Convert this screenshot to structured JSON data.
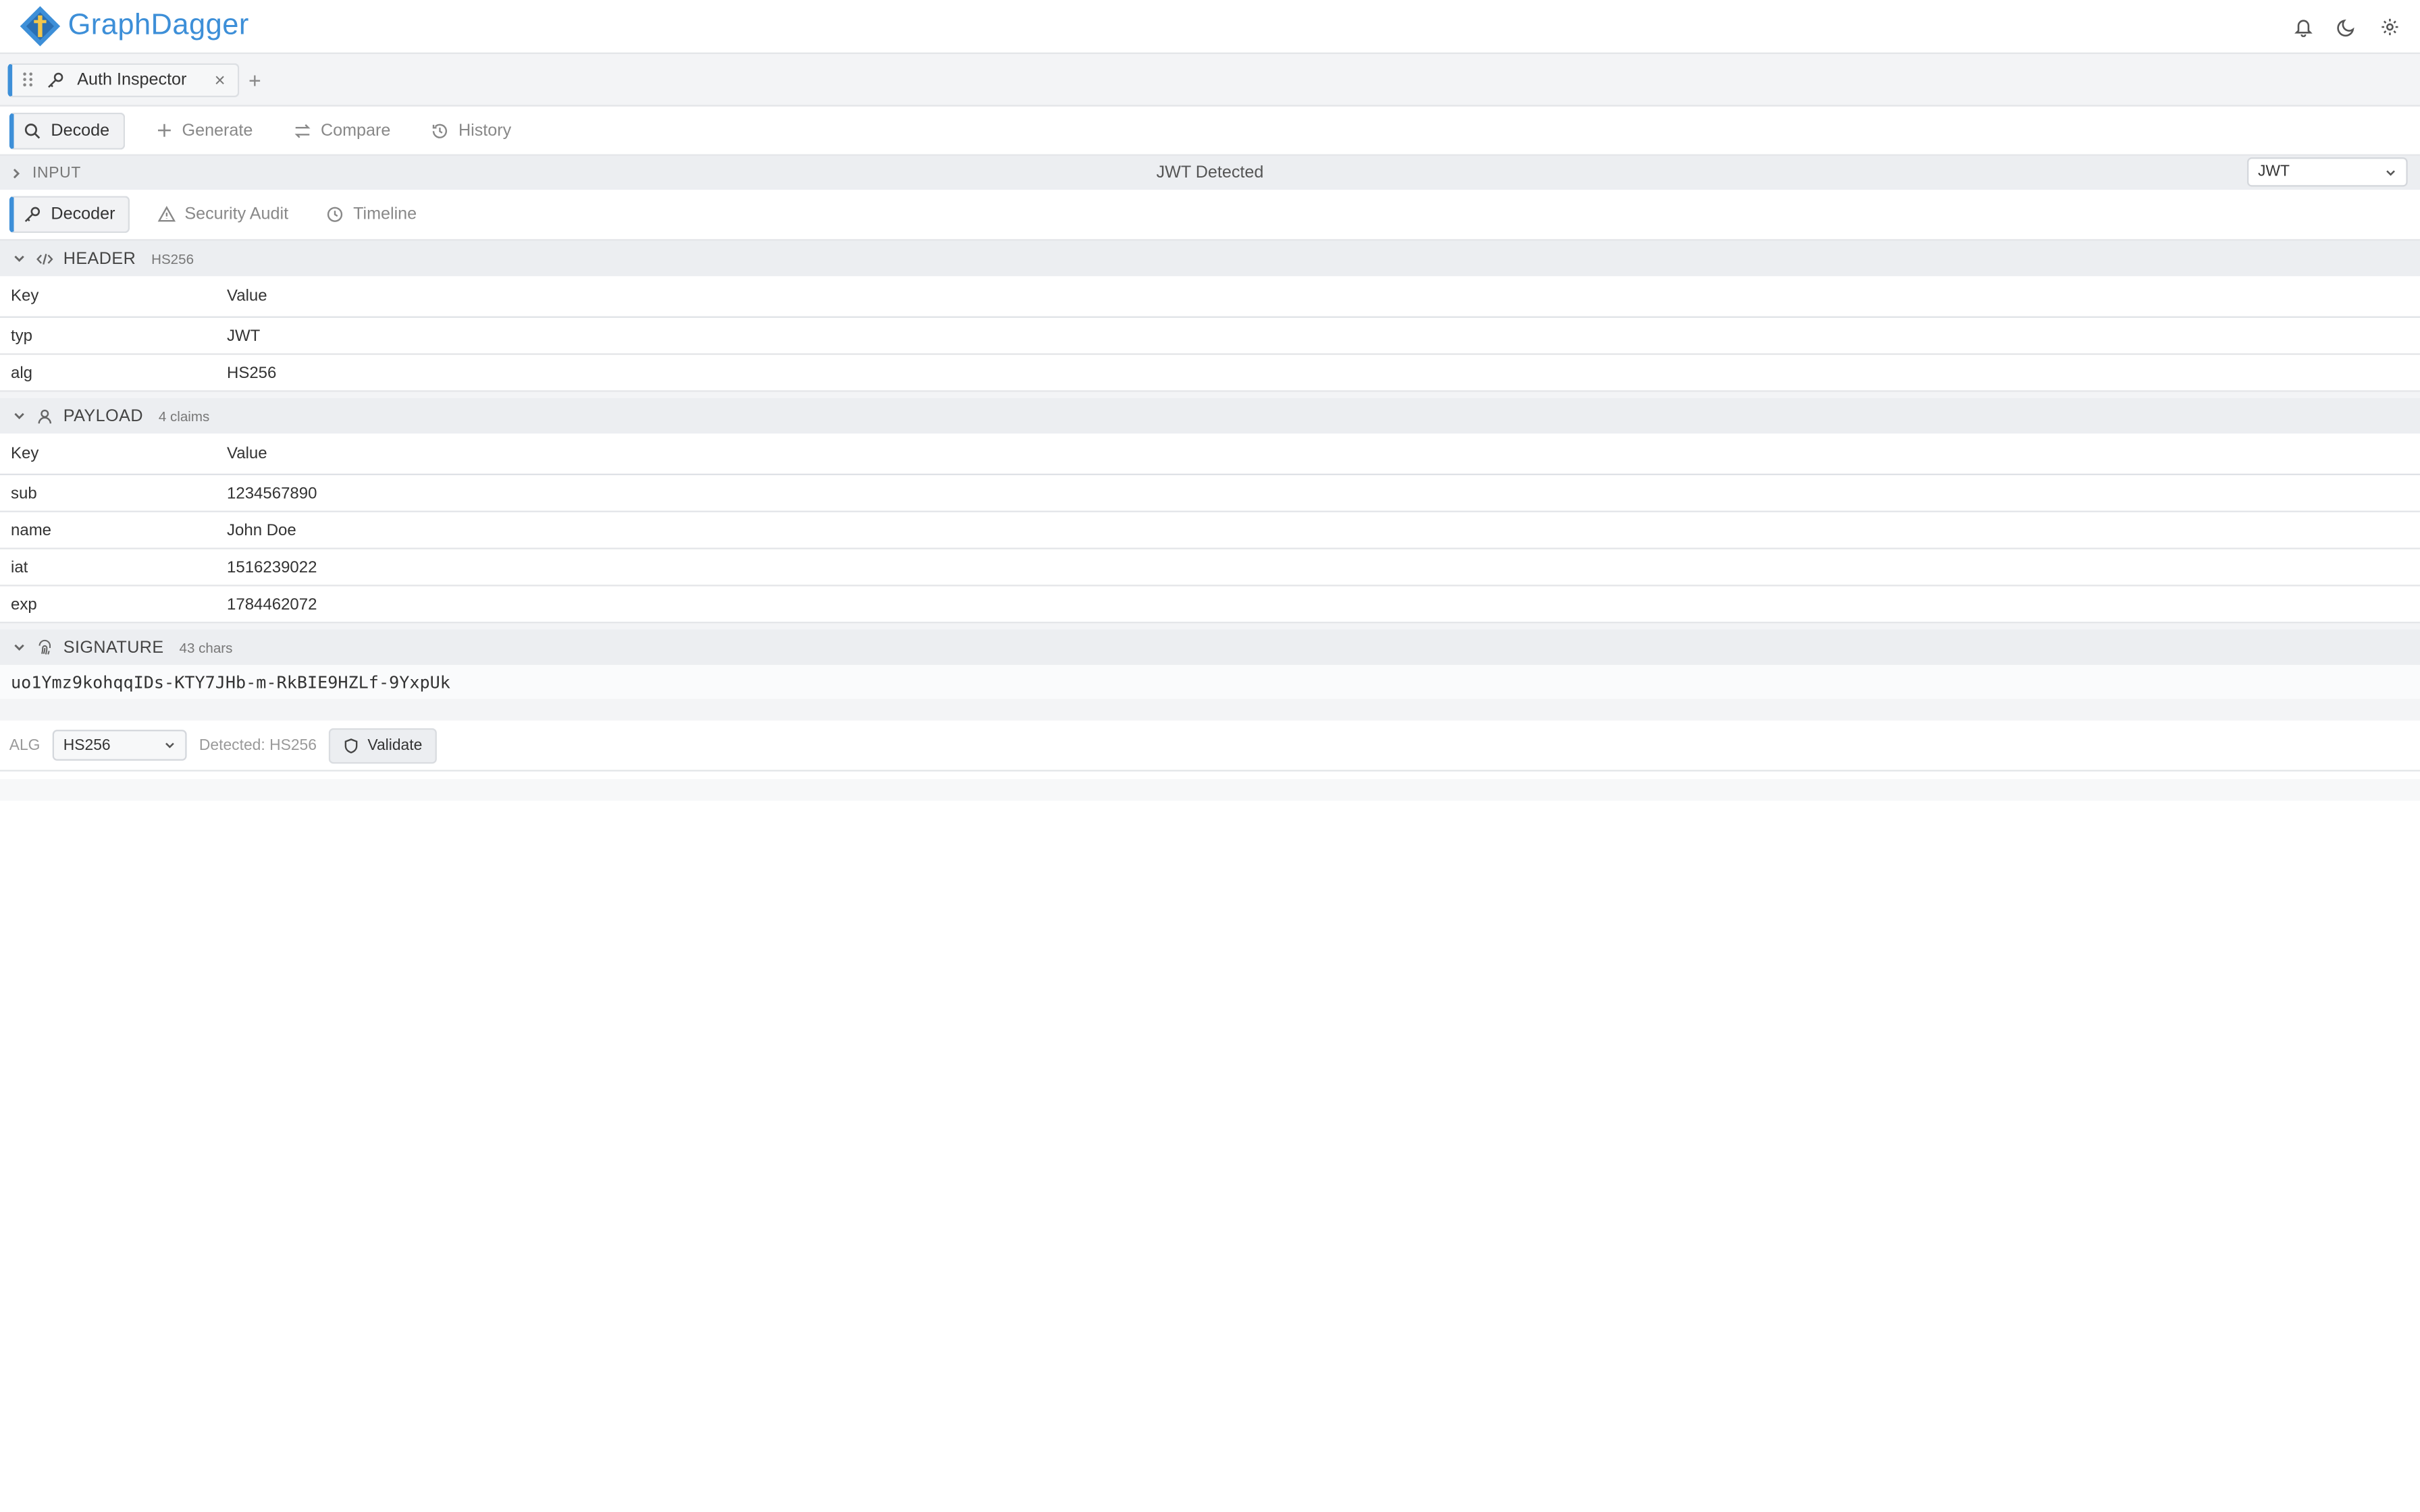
{
  "app": {
    "name": "GraphDagger"
  },
  "header_icons": [
    "bell-icon",
    "moon-icon",
    "gear-icon"
  ],
  "tabs": [
    {
      "label": "Auth Inspector",
      "icon": "key-icon",
      "active": true
    }
  ],
  "modes": [
    {
      "label": "Decode",
      "icon": "search-icon",
      "active": true
    },
    {
      "label": "Generate",
      "icon": "plus-icon"
    },
    {
      "label": "Compare",
      "icon": "arrows-icon"
    },
    {
      "label": "History",
      "icon": "history-icon"
    }
  ],
  "input": {
    "label": "INPUT",
    "status": "JWT Detected",
    "type_value": "JWT"
  },
  "subtabs": [
    {
      "label": "Decoder",
      "icon": "key-icon",
      "active": true
    },
    {
      "label": "Security Audit",
      "icon": "warning-icon"
    },
    {
      "label": "Timeline",
      "icon": "clock-icon"
    }
  ],
  "header_section": {
    "title": "HEADER",
    "badge": "HS256",
    "col_key": "Key",
    "col_value": "Value",
    "rows": [
      {
        "key": "typ",
        "value": "JWT"
      },
      {
        "key": "alg",
        "value": "HS256"
      }
    ]
  },
  "payload_section": {
    "title": "PAYLOAD",
    "badge": "4 claims",
    "col_key": "Key",
    "col_value": "Value",
    "rows": [
      {
        "key": "sub",
        "value": "1234567890"
      },
      {
        "key": "name",
        "value": "John Doe"
      },
      {
        "key": "iat",
        "value": "1516239022"
      },
      {
        "key": "exp",
        "value": "1784462072"
      }
    ]
  },
  "signature_section": {
    "title": "SIGNATURE",
    "badge": "43 chars",
    "value": "uo1Ymz9kohqqIDs-KTY7JHb-m-RkBIE9HZLf-9YxpUk"
  },
  "validation": {
    "alg_label": "ALG",
    "alg_value": "HS256",
    "detected": "Detected: HS256",
    "validate_label": "Validate"
  },
  "colors": {
    "accent": "#3d8fd8",
    "section_bg": "#eceef1",
    "border": "#e3e5e8"
  }
}
